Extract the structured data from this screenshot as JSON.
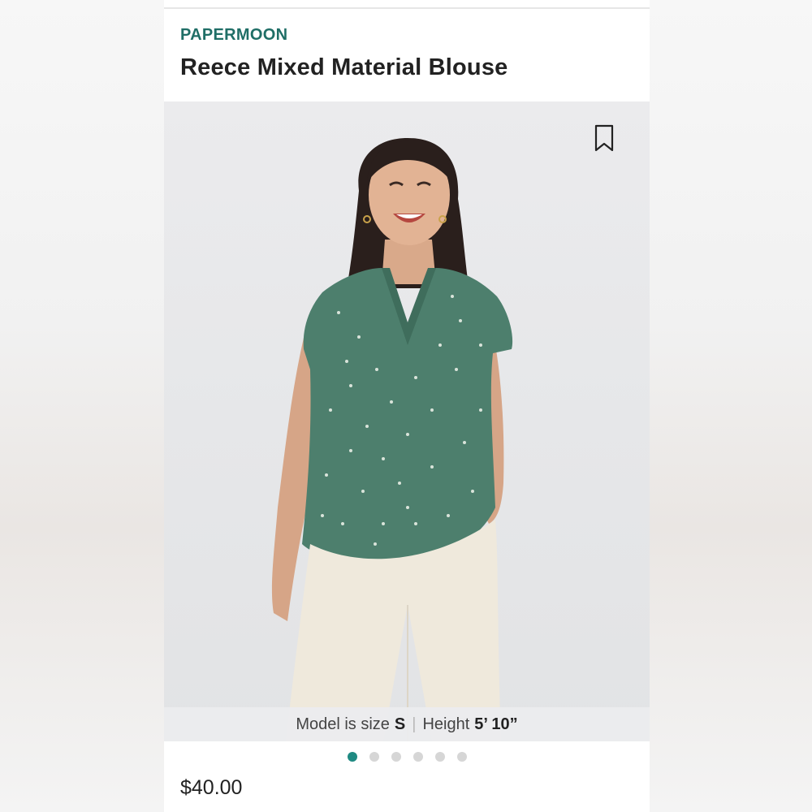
{
  "product": {
    "brand": "PAPERMOON",
    "title": "Reece Mixed Material Blouse",
    "price": "$40.00"
  },
  "model_info": {
    "size_label": "Model is size",
    "size_value": "S",
    "height_label": "Height",
    "height_value": "5’ 10”"
  },
  "carousel": {
    "total": 6,
    "active_index": 0
  },
  "icons": {
    "save": "bookmark-icon"
  },
  "colors": {
    "brand": "#1f6e66",
    "active_dot": "#1f8a82",
    "inactive_dot": "#d6d6d6",
    "blouse": "#4d7f6d",
    "pants": "#efe9dc"
  }
}
